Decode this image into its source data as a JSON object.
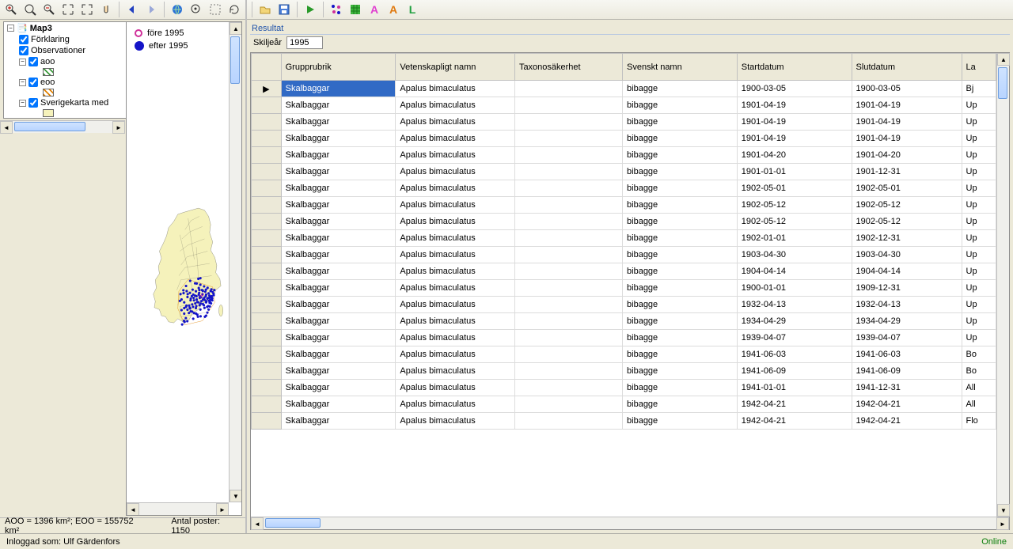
{
  "layers_tree": {
    "root_label": "Map3",
    "items": [
      {
        "label": "Förklaring",
        "checked": true,
        "indent": 1
      },
      {
        "label": "Observationer",
        "checked": true,
        "indent": 1
      },
      {
        "label": "aoo",
        "checked": true,
        "indent": 1,
        "expand": "-"
      },
      {
        "swatch": "diag-green",
        "indent": 3
      },
      {
        "label": "eoo",
        "checked": true,
        "indent": 1,
        "expand": "-"
      },
      {
        "swatch": "diag-orange",
        "indent": 3
      },
      {
        "label": "Sverigekarta med",
        "checked": true,
        "indent": 1,
        "expand": "-"
      },
      {
        "swatch": "solid-cream",
        "indent": 3
      }
    ]
  },
  "legend": {
    "before_label": "före 1995",
    "after_label": "efter 1995"
  },
  "left_status": {
    "aoo_eoo": "AOO = 1396 km²; EOO = 155752 km²",
    "antal": "Antal poster: 1150"
  },
  "resultat": {
    "title": "Resultat",
    "filter_label": "Skiljeår",
    "filter_value": "1995"
  },
  "columns": [
    "",
    "Grupprubrik",
    "Vetenskapligt namn",
    "Taxonosäkerhet",
    "Svenskt namn",
    "Startdatum",
    "Slutdatum",
    "La"
  ],
  "rows": [
    {
      "g": "Skalbaggar",
      "v": "Apalus bimaculatus",
      "t": "",
      "s": "bibagge",
      "sd": "1900-03-05",
      "ed": "1900-03-05",
      "l": "Bj"
    },
    {
      "g": "Skalbaggar",
      "v": "Apalus bimaculatus",
      "t": "",
      "s": "bibagge",
      "sd": "1901-04-19",
      "ed": "1901-04-19",
      "l": "Up"
    },
    {
      "g": "Skalbaggar",
      "v": "Apalus bimaculatus",
      "t": "",
      "s": "bibagge",
      "sd": "1901-04-19",
      "ed": "1901-04-19",
      "l": "Up"
    },
    {
      "g": "Skalbaggar",
      "v": "Apalus bimaculatus",
      "t": "",
      "s": "bibagge",
      "sd": "1901-04-19",
      "ed": "1901-04-19",
      "l": "Up"
    },
    {
      "g": "Skalbaggar",
      "v": "Apalus bimaculatus",
      "t": "",
      "s": "bibagge",
      "sd": "1901-04-20",
      "ed": "1901-04-20",
      "l": "Up"
    },
    {
      "g": "Skalbaggar",
      "v": "Apalus bimaculatus",
      "t": "",
      "s": "bibagge",
      "sd": "1901-01-01",
      "ed": "1901-12-31",
      "l": "Up"
    },
    {
      "g": "Skalbaggar",
      "v": "Apalus bimaculatus",
      "t": "",
      "s": "bibagge",
      "sd": "1902-05-01",
      "ed": "1902-05-01",
      "l": "Up"
    },
    {
      "g": "Skalbaggar",
      "v": "Apalus bimaculatus",
      "t": "",
      "s": "bibagge",
      "sd": "1902-05-12",
      "ed": "1902-05-12",
      "l": "Up"
    },
    {
      "g": "Skalbaggar",
      "v": "Apalus bimaculatus",
      "t": "",
      "s": "bibagge",
      "sd": "1902-05-12",
      "ed": "1902-05-12",
      "l": "Up"
    },
    {
      "g": "Skalbaggar",
      "v": "Apalus bimaculatus",
      "t": "",
      "s": "bibagge",
      "sd": "1902-01-01",
      "ed": "1902-12-31",
      "l": "Up"
    },
    {
      "g": "Skalbaggar",
      "v": "Apalus bimaculatus",
      "t": "",
      "s": "bibagge",
      "sd": "1903-04-30",
      "ed": "1903-04-30",
      "l": "Up"
    },
    {
      "g": "Skalbaggar",
      "v": "Apalus bimaculatus",
      "t": "",
      "s": "bibagge",
      "sd": "1904-04-14",
      "ed": "1904-04-14",
      "l": "Up"
    },
    {
      "g": "Skalbaggar",
      "v": "Apalus bimaculatus",
      "t": "",
      "s": "bibagge",
      "sd": "1900-01-01",
      "ed": "1909-12-31",
      "l": "Up"
    },
    {
      "g": "Skalbaggar",
      "v": "Apalus bimaculatus",
      "t": "",
      "s": "bibagge",
      "sd": "1932-04-13",
      "ed": "1932-04-13",
      "l": "Up"
    },
    {
      "g": "Skalbaggar",
      "v": "Apalus bimaculatus",
      "t": "",
      "s": "bibagge",
      "sd": "1934-04-29",
      "ed": "1934-04-29",
      "l": "Up"
    },
    {
      "g": "Skalbaggar",
      "v": "Apalus bimaculatus",
      "t": "",
      "s": "bibagge",
      "sd": "1939-04-07",
      "ed": "1939-04-07",
      "l": "Up"
    },
    {
      "g": "Skalbaggar",
      "v": "Apalus bimaculatus",
      "t": "",
      "s": "bibagge",
      "sd": "1941-06-03",
      "ed": "1941-06-03",
      "l": "Bo"
    },
    {
      "g": "Skalbaggar",
      "v": "Apalus bimaculatus",
      "t": "",
      "s": "bibagge",
      "sd": "1941-06-09",
      "ed": "1941-06-09",
      "l": "Bo"
    },
    {
      "g": "Skalbaggar",
      "v": "Apalus bimaculatus",
      "t": "",
      "s": "bibagge",
      "sd": "1941-01-01",
      "ed": "1941-12-31",
      "l": "All"
    },
    {
      "g": "Skalbaggar",
      "v": "Apalus bimaculatus",
      "t": "",
      "s": "bibagge",
      "sd": "1942-04-21",
      "ed": "1942-04-21",
      "l": "All"
    },
    {
      "g": "Skalbaggar",
      "v": "Apalus bimaculatus",
      "t": "",
      "s": "bibagge",
      "sd": "1942-04-21",
      "ed": "1942-04-21",
      "l": "Flo"
    }
  ],
  "statusbar": {
    "login": "Inloggad som: Ulf Gärdenfors",
    "online": "Online"
  },
  "map_points": [
    [
      334,
      377
    ],
    [
      310,
      365
    ],
    [
      290,
      390
    ],
    [
      277,
      411
    ],
    [
      263,
      430
    ],
    [
      268,
      456
    ],
    [
      281,
      470
    ],
    [
      292,
      486
    ],
    [
      310,
      500
    ],
    [
      338,
      498
    ],
    [
      304,
      522
    ],
    [
      289,
      547
    ],
    [
      283,
      565
    ],
    [
      271,
      578
    ],
    [
      296,
      562
    ],
    [
      325,
      550
    ],
    [
      348,
      540
    ],
    [
      339,
      525
    ],
    [
      320,
      515
    ],
    [
      360,
      505
    ],
    [
      380,
      497
    ],
    [
      398,
      488
    ],
    [
      407,
      469
    ],
    [
      418,
      450
    ],
    [
      424,
      428
    ],
    [
      428,
      410
    ],
    [
      414,
      407
    ],
    [
      395,
      399
    ],
    [
      378,
      392
    ],
    [
      360,
      384
    ],
    [
      342,
      378
    ],
    [
      352,
      400
    ],
    [
      368,
      410
    ],
    [
      384,
      418
    ],
    [
      400,
      426
    ],
    [
      409,
      444
    ],
    [
      395,
      450
    ],
    [
      380,
      458
    ],
    [
      365,
      464
    ],
    [
      350,
      470
    ],
    [
      335,
      475
    ],
    [
      320,
      480
    ],
    [
      305,
      486
    ],
    [
      290,
      492
    ],
    [
      334,
      437
    ],
    [
      352,
      432
    ],
    [
      370,
      430
    ],
    [
      388,
      432
    ],
    [
      404,
      437
    ],
    [
      414,
      454
    ],
    [
      402,
      462
    ],
    [
      388,
      470
    ],
    [
      372,
      478
    ],
    [
      356,
      484
    ],
    [
      340,
      488
    ],
    [
      324,
      492
    ],
    [
      308,
      496
    ],
    [
      293,
      415
    ],
    [
      309,
      424
    ],
    [
      325,
      432
    ],
    [
      341,
      440
    ],
    [
      357,
      448
    ],
    [
      373,
      456
    ],
    [
      389,
      464
    ],
    [
      405,
      472
    ],
    [
      322,
      408
    ],
    [
      338,
      416
    ],
    [
      354,
      424
    ],
    [
      370,
      432
    ],
    [
      386,
      440
    ],
    [
      402,
      448
    ],
    [
      297,
      444
    ],
    [
      313,
      452
    ],
    [
      329,
      460
    ],
    [
      345,
      468
    ],
    [
      361,
      476
    ],
    [
      377,
      484
    ],
    [
      393,
      492
    ],
    [
      281,
      498
    ],
    [
      297,
      506
    ],
    [
      313,
      514
    ],
    [
      329,
      522
    ],
    [
      345,
      530
    ],
    [
      361,
      538
    ],
    [
      415,
      440
    ],
    [
      420,
      420
    ],
    [
      425,
      435
    ],
    [
      410,
      415
    ],
    [
      418,
      460
    ],
    [
      412,
      475
    ],
    [
      406,
      490
    ],
    [
      400,
      505
    ],
    [
      394,
      520
    ],
    [
      388,
      535
    ],
    [
      382,
      540
    ],
    [
      281,
      525
    ],
    [
      268,
      508
    ],
    [
      260,
      463
    ],
    [
      318,
      440
    ],
    [
      298,
      430
    ],
    [
      278,
      425
    ],
    [
      312,
      460
    ],
    [
      327,
      448
    ],
    [
      342,
      456
    ],
    [
      357,
      440
    ],
    [
      372,
      414
    ],
    [
      387,
      408
    ],
    [
      355,
      410
    ],
    [
      364,
      445
    ],
    [
      379,
      447
    ],
    [
      394,
      452
    ],
    [
      408,
      458
    ],
    [
      360,
      352
    ],
    [
      350,
      355
    ],
    [
      280,
      560
    ]
  ]
}
